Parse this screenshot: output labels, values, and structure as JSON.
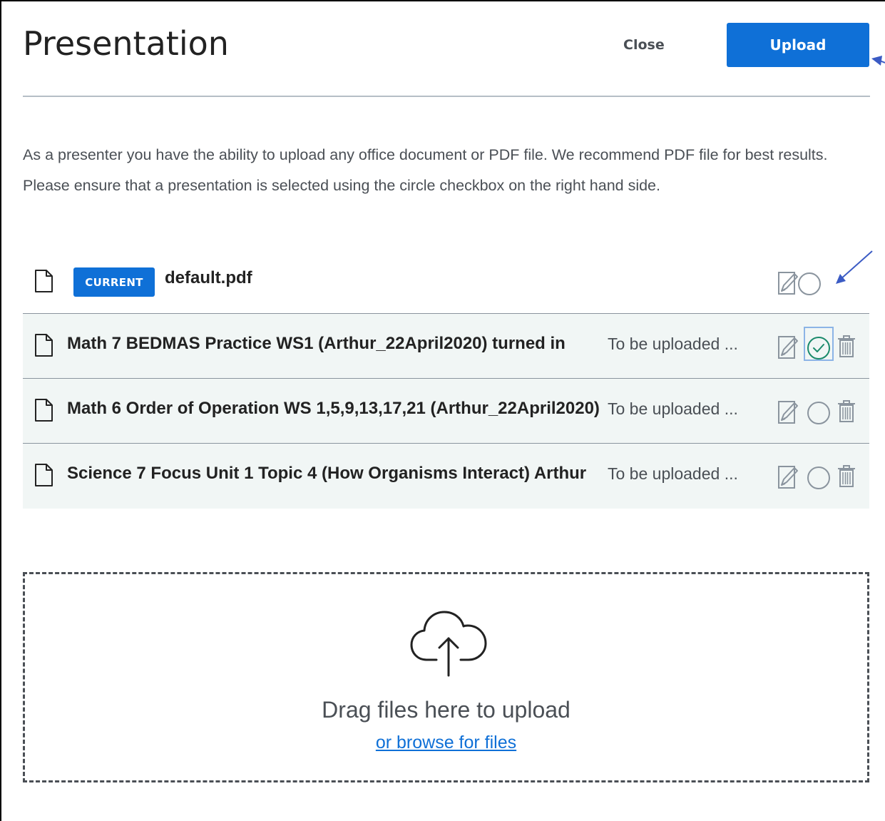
{
  "header": {
    "title": "Presentation",
    "close_label": "Close",
    "upload_label": "Upload"
  },
  "description": "As a presenter you have the ability to upload any office document or PDF file. We recommend PDF file for best results. Please ensure that a presentation is selected using the circle checkbox on the right hand side.",
  "current_file": {
    "badge": "CURRENT",
    "name": "default.pdf"
  },
  "pending_files": [
    {
      "name": "Math 7 BEDMAS Practice WS1 (Arthur_22April2020) turned in",
      "status": "To be uploaded ...",
      "selected": true
    },
    {
      "name": "Math 6 Order of Operation WS 1,5,9,13,17,21 (Arthur_22April2020)",
      "status": "To be uploaded ...",
      "selected": false
    },
    {
      "name": "Science 7 Focus Unit 1 Topic 4 (How Organisms Interact) Arthur",
      "status": "To be uploaded ...",
      "selected": false
    }
  ],
  "dropzone": {
    "drag_text": "Drag files here to upload",
    "browse_text": "or browse for files"
  },
  "colors": {
    "accent": "#0f70d7",
    "selected_check": "#1a8a6b",
    "row_bg": "#f1f6f5",
    "annotation_arrow": "#3b5bc4"
  },
  "icons": {
    "file": "file-icon",
    "edit": "edit-icon",
    "select": "circle-checkbox-icon",
    "trash": "trash-icon",
    "upload": "cloud-upload-icon"
  }
}
